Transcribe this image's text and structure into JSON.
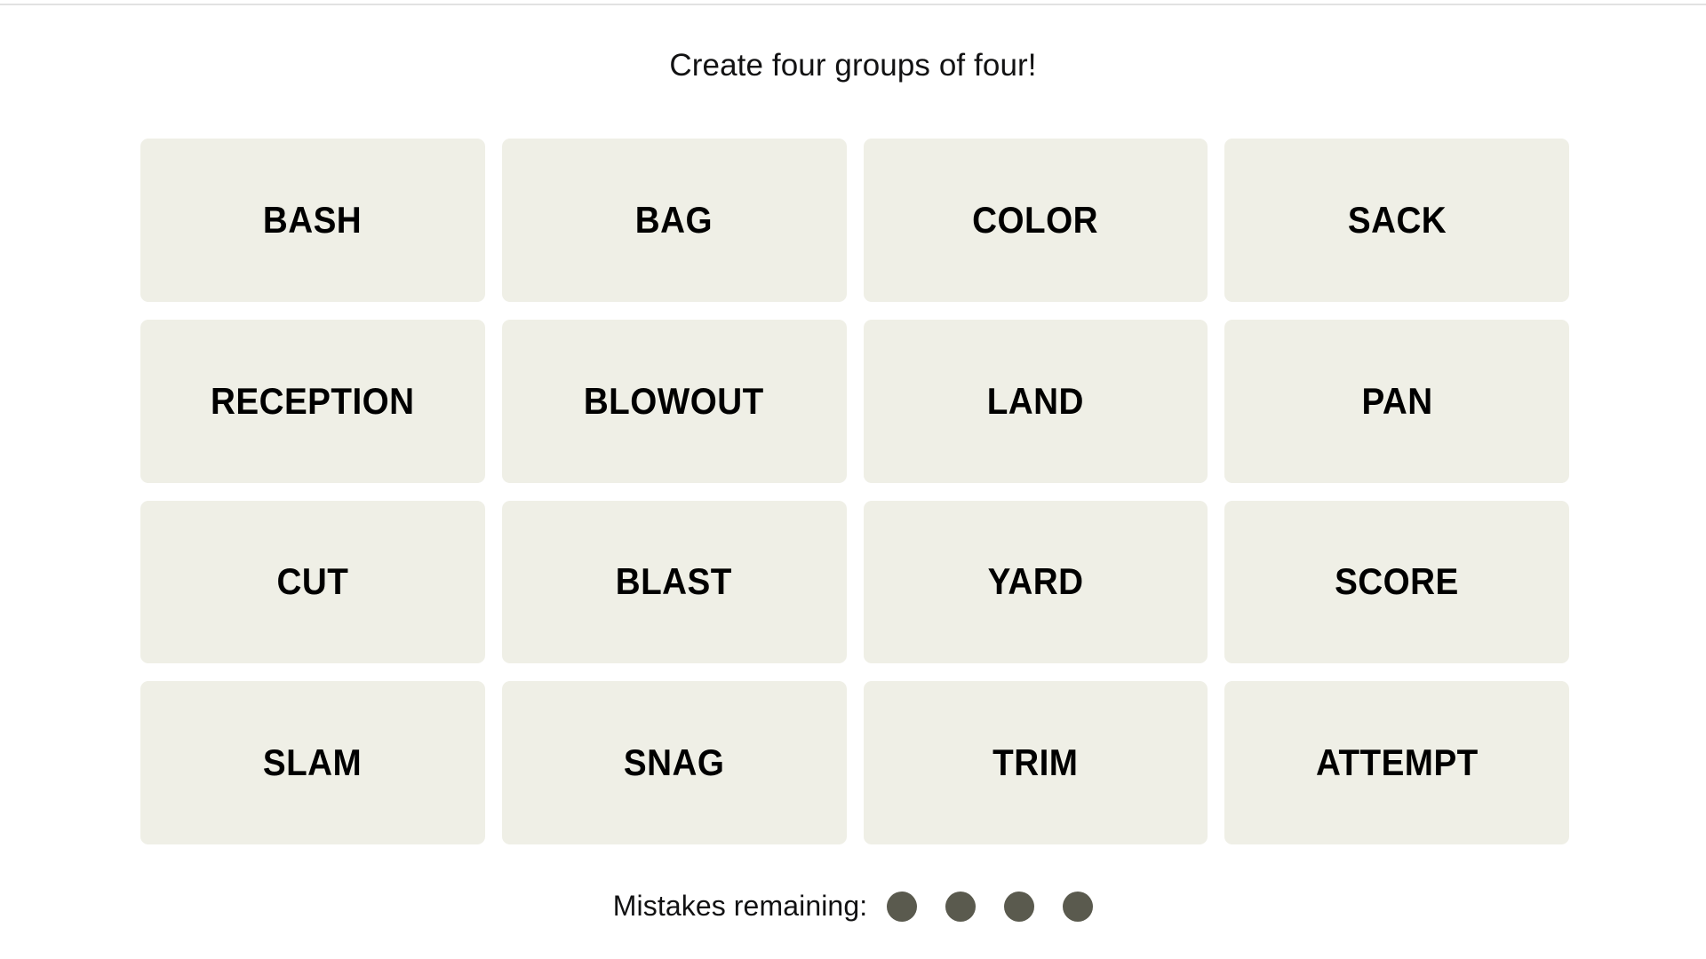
{
  "page": {
    "background_color": "#ffffff",
    "top_rule_color": "#e2e2e2"
  },
  "header": {
    "title": "Create four groups of four!"
  },
  "board": {
    "rows": 4,
    "columns": 4,
    "tile_color": "#efefe6",
    "tile_text_color": "#000000",
    "tiles": [
      {
        "label": "BASH"
      },
      {
        "label": "BAG"
      },
      {
        "label": "COLOR"
      },
      {
        "label": "SACK"
      },
      {
        "label": "RECEPTION"
      },
      {
        "label": "BLOWOUT"
      },
      {
        "label": "LAND"
      },
      {
        "label": "PAN"
      },
      {
        "label": "CUT"
      },
      {
        "label": "BLAST"
      },
      {
        "label": "YARD"
      },
      {
        "label": "SCORE"
      },
      {
        "label": "SLAM"
      },
      {
        "label": "SNAG"
      },
      {
        "label": "TRIM"
      },
      {
        "label": "ATTEMPT"
      }
    ]
  },
  "footer": {
    "mistakes_label": "Mistakes remaining:",
    "mistakes_remaining": 4,
    "dot_color": "#5a5a4e",
    "dots": [
      {
        "state": "remaining"
      },
      {
        "state": "remaining"
      },
      {
        "state": "remaining"
      },
      {
        "state": "remaining"
      }
    ]
  }
}
